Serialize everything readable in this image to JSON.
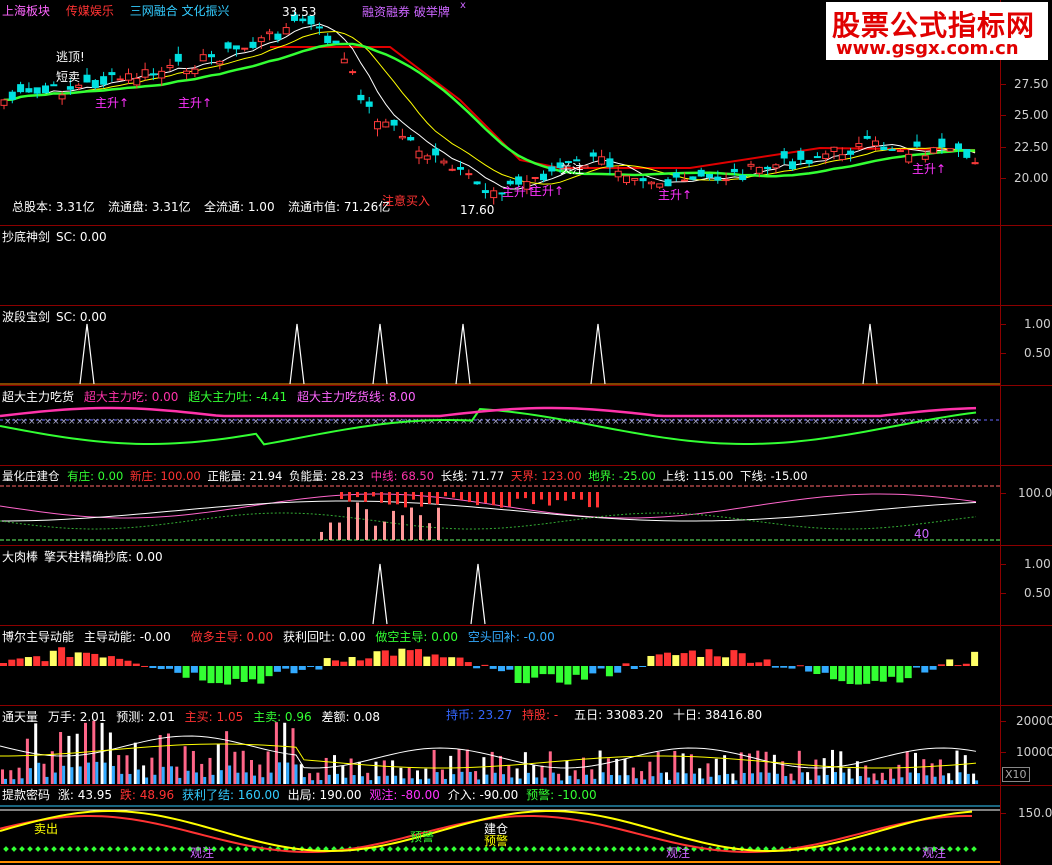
{
  "colors": {
    "up": "#ff3b3b",
    "down": "#00e0e0",
    "yellow": "#ffff00",
    "white": "#ffffff",
    "green": "#00ff00",
    "magenta": "#ff00ff",
    "orange": "#ff8c00",
    "axis": "#8b0000"
  },
  "main": {
    "tags": [
      {
        "text": "上海板块",
        "color": "#ff66ff"
      },
      {
        "text": "传媒娱乐",
        "color": "#ff3333"
      },
      {
        "text": "三网融合 文化振兴",
        "color": "#33ccff"
      },
      {
        "text": "融资融券 破举牌",
        "color": "#cc66ff"
      }
    ],
    "high_label": "33.53",
    "low_label": "17.60",
    "escape_label": "逃顶!",
    "short_label": "短卖",
    "buy_label": "注意买入",
    "rise_labels": [
      "主升↑",
      "主升↑",
      "主升↑",
      "主升↑",
      "主升↑",
      "主升↑"
    ],
    "watch_label": "关注",
    "info": {
      "total": "总股本: 3.31亿",
      "float": "流通盘: 3.31亿",
      "full": "全流通: 1.00",
      "mktcap": "流通市值: 71.26亿"
    },
    "ticks": [
      "27.50",
      "25.00",
      "22.50",
      "20.00"
    ],
    "close": "x"
  },
  "watermark": {
    "cn": "股票公式指标网",
    "url": "www.gsgx.com.cn"
  },
  "p1": {
    "title": "抄底神剑",
    "sc": "SC: 0.00"
  },
  "p2": {
    "title": "波段宝剑",
    "sc": "SC: 0.00",
    "ticks": [
      "1.00",
      "0.50"
    ]
  },
  "p3": {
    "title": "超大主力吃货",
    "items": [
      {
        "text": "超大主力吃: 0.00",
        "color": "#ff33aa"
      },
      {
        "text": "超大主力吐: -4.41",
        "color": "#33ff33"
      },
      {
        "text": "超大主力吃货线: 8.00",
        "color": "#ff66ff"
      }
    ]
  },
  "p4": {
    "title": "量化庄建仓",
    "items": [
      {
        "text": "有庄: 0.00",
        "color": "#33ff33"
      },
      {
        "text": "新庄: 100.00",
        "color": "#ff3333"
      },
      {
        "text": "正能量: 21.94",
        "color": "#ffffff"
      },
      {
        "text": "负能量: 28.23",
        "color": "#ffffff"
      },
      {
        "text": "中线: 68.50",
        "color": "#ff33aa"
      },
      {
        "text": "长线: 71.77",
        "color": "#ffffff"
      },
      {
        "text": "天界: 123.00",
        "color": "#ff3333"
      },
      {
        "text": "地界: -25.00",
        "color": "#33ff33"
      },
      {
        "text": "上线: 115.00",
        "color": "#ffffff"
      },
      {
        "text": "下线: -15.00",
        "color": "#ffffff"
      }
    ],
    "tick": "100.0",
    "level_label": "40"
  },
  "p5": {
    "title": "大肉棒",
    "sub": "擎天柱精确抄底: 0.00",
    "ticks": [
      "1.00",
      "0.50"
    ]
  },
  "p6": {
    "title": "博尔主导动能",
    "items": [
      {
        "text": "主导动能: -0.00",
        "color": "#ffffff"
      },
      {
        "text": "做多主导: 0.00",
        "color": "#ff3333"
      },
      {
        "text": "获利回吐: 0.00",
        "color": "#ffffff"
      },
      {
        "text": "做空主导: 0.00",
        "color": "#33ff33"
      },
      {
        "text": "空头回补: -0.00",
        "color": "#33aaff"
      }
    ]
  },
  "p7": {
    "title": "通天量",
    "items": [
      {
        "text": "万手: 2.01",
        "color": "#ffffff"
      },
      {
        "text": "预测: 2.01",
        "color": "#ffffff"
      },
      {
        "text": "主买: 1.05",
        "color": "#ff3333"
      },
      {
        "text": "主卖: 0.96",
        "color": "#33ff33"
      },
      {
        "text": "差额: 0.08",
        "color": "#ffffff"
      }
    ],
    "items2": [
      {
        "text": "持币: 23.27",
        "color": "#3366ff"
      },
      {
        "text": "持股: -",
        "color": "#ff3333"
      },
      {
        "text": "五日: 33083.20",
        "color": "#ffffff"
      },
      {
        "text": "十日: 38416.80",
        "color": "#ffffff"
      }
    ],
    "ticks": [
      "20000",
      "10000"
    ],
    "x10": "X10"
  },
  "p8": {
    "title": "提款密码",
    "items": [
      {
        "text": "涨: 43.95",
        "color": "#ffffff"
      },
      {
        "text": "跌: 48.96",
        "color": "#ff3333"
      },
      {
        "text": "获利了结: 160.00",
        "color": "#33ccff"
      },
      {
        "text": "出局: 190.00",
        "color": "#ffffff"
      },
      {
        "text": "观注: -80.00",
        "color": "#ff33ff"
      },
      {
        "text": "介入: -90.00",
        "color": "#ffffff"
      },
      {
        "text": "预警: -10.00",
        "color": "#33ff33"
      }
    ],
    "tick": "150.0",
    "warn": "预警",
    "build": "建仓",
    "watch": "观注",
    "sell": "卖出",
    "warn2": "预警"
  }
}
